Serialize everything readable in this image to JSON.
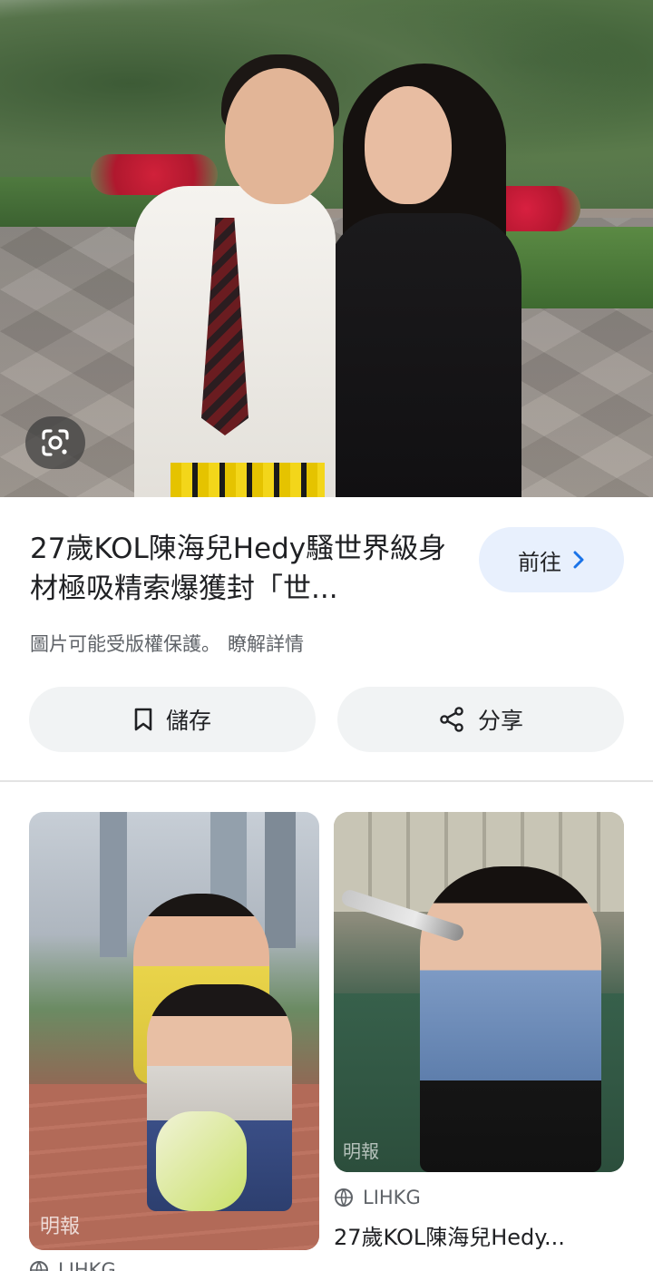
{
  "result": {
    "title": "27歲KOL陳海兒Hedy騷世界級身材極吸精索爆獲封「世...",
    "visit_label": "前往",
    "copyright_notice": "圖片可能受版權保護。",
    "learn_more": "瞭解詳情",
    "save_label": "儲存",
    "share_label": "分享"
  },
  "related": [
    {
      "watermark": "明報",
      "source": "LIHKG"
    },
    {
      "watermark": "明報",
      "source": "LIHKG",
      "title": "27歲KOL陳海兒Hedy..."
    }
  ],
  "icons": {
    "lens": "google-lens-icon",
    "visit": "chevron-right-icon",
    "save": "bookmark-icon",
    "share": "share-icon",
    "source": "globe-icon"
  },
  "colors": {
    "accent": "#1a73e8",
    "visit_bg": "#e8f0fd",
    "button_bg": "#f1f3f4",
    "secondary_text": "#5f6368"
  }
}
